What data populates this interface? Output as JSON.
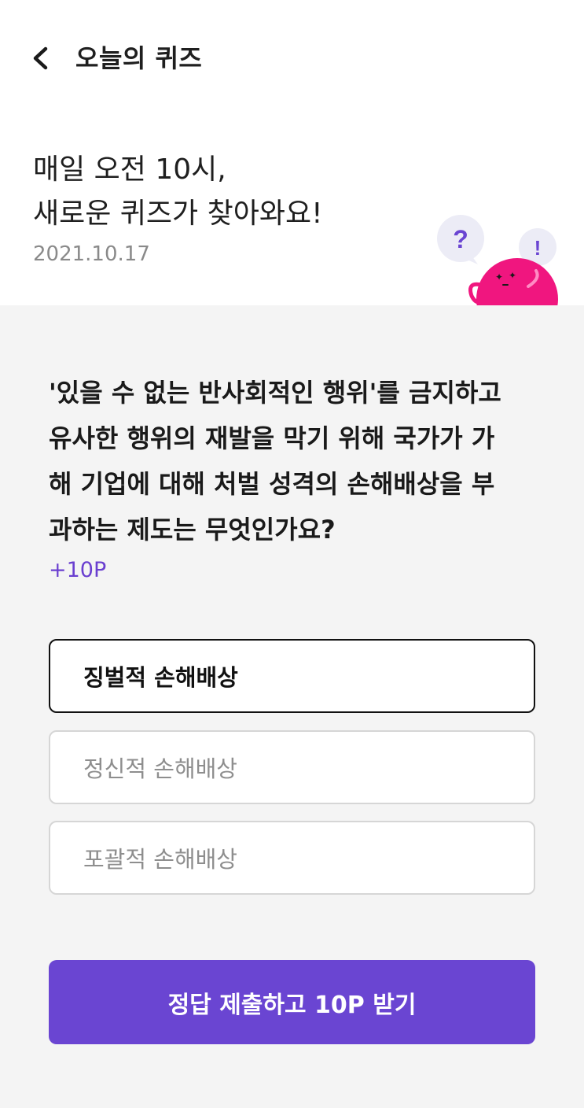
{
  "header": {
    "title": "오늘의 퀴즈",
    "back_icon": "chevron-left-icon"
  },
  "intro": {
    "line1": "매일 오전 10시,",
    "line2": "새로운 퀴즈가 찾아와요!",
    "date": "2021.10.17",
    "mascot_icon": "quiz-mascot-illustration",
    "mascot_question_mark": "?",
    "mascot_exclamation_mark": "!"
  },
  "quiz": {
    "question_lines": [
      "'있을 수 없는 반사회적인 행위'를 금지하고",
      "유사한 행위의 재발을 막기 위해 국가가 가",
      "해 기업에 대해 처벌 성격의 손해배상을 부",
      "과하는 제도는 무엇인가요?"
    ],
    "points": "+10P",
    "options": [
      {
        "label": "징벌적 손해배상",
        "selected": true
      },
      {
        "label": "정신적 손해배상",
        "selected": false
      },
      {
        "label": "포괄적 손해배상",
        "selected": false
      }
    ],
    "submit_label": "정답 제출하고 10P 받기"
  },
  "colors": {
    "accent": "#6a45d2",
    "points_text": "#6a3fd0",
    "mascot_pink": "#f0167f",
    "bubble_bg": "#ececf6"
  }
}
